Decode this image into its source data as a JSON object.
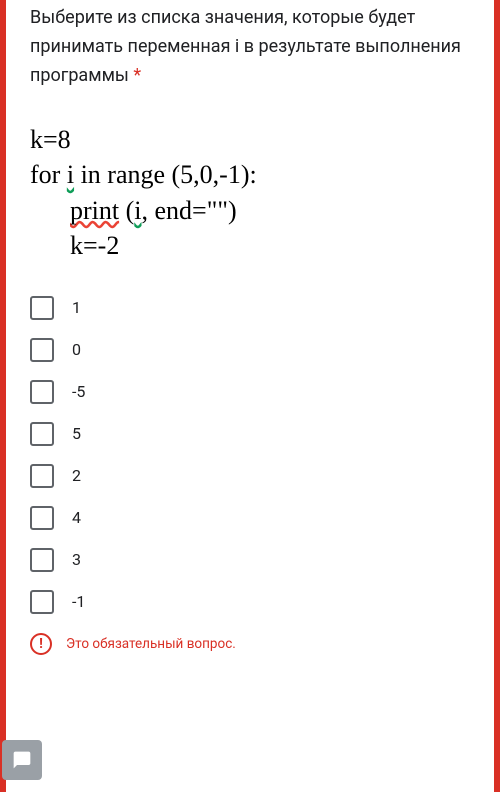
{
  "question": {
    "text": "Выберите из списка значения, которые будет принимать переменная i в результате выполнения программы",
    "required_marker": "*"
  },
  "code": {
    "line1": "k=8",
    "line2_a": "for ",
    "line2_b": "i",
    "line2_c": " in range (5,0,-1):",
    "line3_a": "print",
    "line3_b": " (",
    "line3_c": "i",
    "line3_d": ", end=\"\")",
    "line4": "k=-2"
  },
  "options": [
    {
      "label": "1"
    },
    {
      "label": "0"
    },
    {
      "label": "-5"
    },
    {
      "label": "5"
    },
    {
      "label": "2"
    },
    {
      "label": "4"
    },
    {
      "label": "3"
    },
    {
      "label": "-1"
    }
  ],
  "error": {
    "text": "Это обязательный вопрос.",
    "exclamation": "!"
  }
}
